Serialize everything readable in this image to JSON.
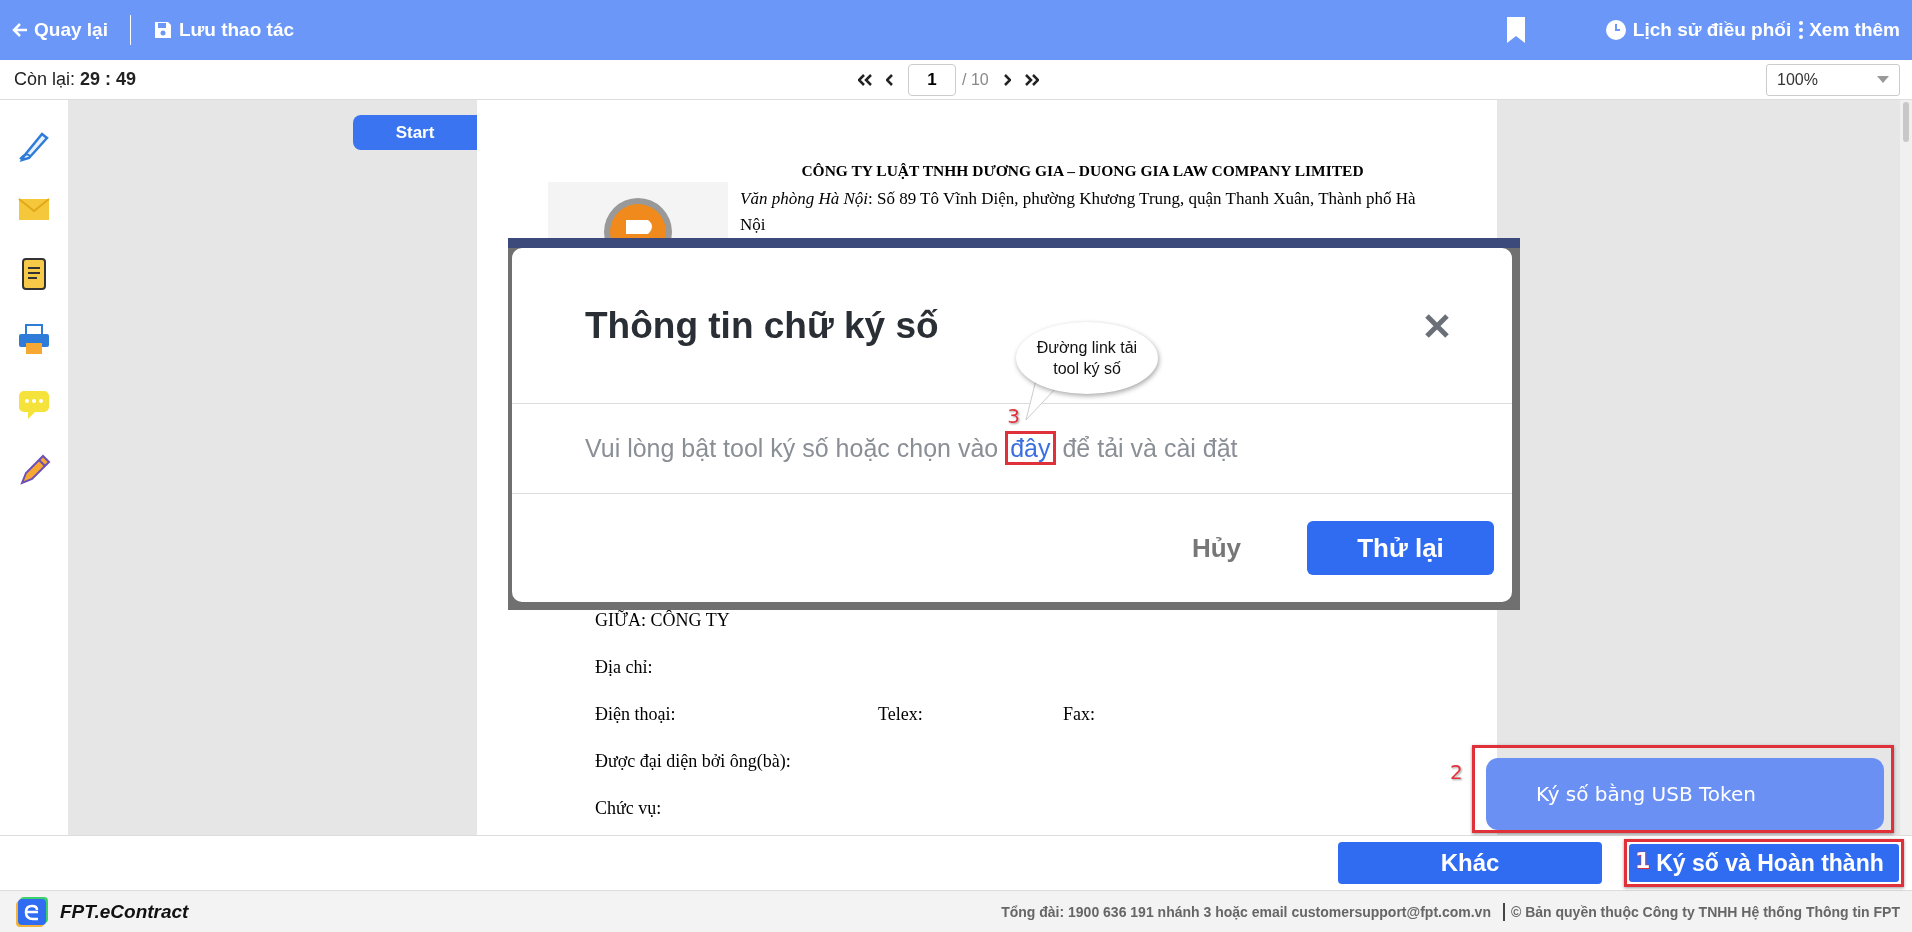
{
  "top_bar": {
    "back": "Quay lại",
    "save": "Lưu thao tác",
    "history": "Lịch sử điều phối",
    "more": "Xem thêm"
  },
  "toolbar": {
    "timer_label": "Còn lại:",
    "timer": "29 : 49",
    "page": "1",
    "page_total": "/ 10",
    "zoom": "100%"
  },
  "start_button": "Start",
  "document": {
    "heading": "CÔNG TY LUẬT TNHH DƯƠNG GIA – DUONG GIA LAW COMPANY LIMITED",
    "address": "*Văn phòng Hà Nội*: Số 89 Tô Vĩnh Diện, phường Khương Trung, quận Thanh Xuân, Thành phố Hà Nội",
    "lines": [
      [
        "GIỮA: CÔNG TY"
      ],
      [
        "Địa chỉ:"
      ],
      [
        "Điện thoại:",
        "Telex:",
        "Fax:"
      ],
      [
        "Được đại diện bởi ông(bà):"
      ],
      [
        "Chức vụ:"
      ]
    ]
  },
  "dialog": {
    "title": "Thông tin chữ ký số",
    "message_start": "Vui lòng bật tool ký số hoặc chọn vào",
    "link": "đây",
    "message_end": "để tải và cài đặt",
    "step": "3",
    "tooltip": "Đường link tải tool ký số",
    "cancel": "Hủy",
    "retry": "Thử lại"
  },
  "usb_option": {
    "label": "Ký số bằng USB Token",
    "step": "2"
  },
  "actions": {
    "other": "Khác",
    "sign": "Ký số và Hoàn thành",
    "step": "1"
  },
  "footer": {
    "brand": "FPT.eContract",
    "contact": "Tổng đài: 1900 636 191 nhánh 3 hoặc email customersupport@fpt.com.vn",
    "copyright": "© Bản quyền thuộc Công ty TNHH Hệ thống Thông tin FPT"
  }
}
